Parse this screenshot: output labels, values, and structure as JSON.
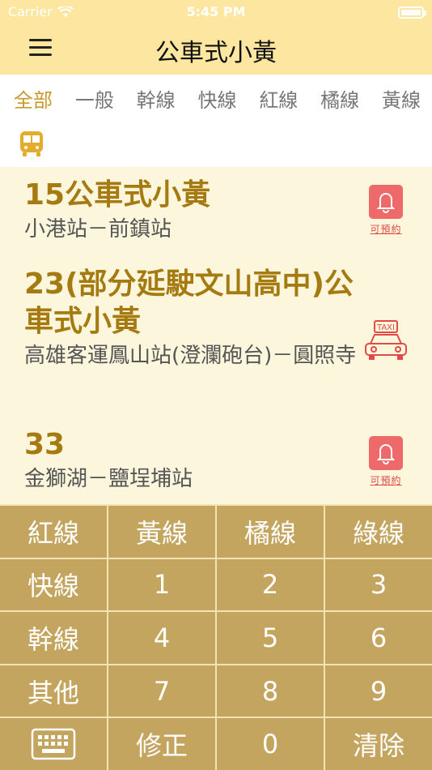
{
  "status_bar": {
    "carrier": "Carrier",
    "time": "5:45 PM"
  },
  "header": {
    "title": "公車式小黃"
  },
  "tabs": [
    {
      "label": "全部",
      "active": true
    },
    {
      "label": "一般"
    },
    {
      "label": "幹線"
    },
    {
      "label": "快線"
    },
    {
      "label": "紅線"
    },
    {
      "label": "橘線"
    },
    {
      "label": "黃線"
    }
  ],
  "routes": [
    {
      "name": "15公車式小黃",
      "stops": "小港站－前鎮站",
      "badge": {
        "icon": "bell-icon",
        "label": "可預約"
      }
    },
    {
      "name": "23(部分延駛文山高中)公車式小黃",
      "stops": "高雄客運鳳山站(澄瀾砲台)－圓照寺",
      "badge": {
        "icon": "taxi-icon",
        "label": "TAXI"
      }
    },
    {
      "name": "33",
      "stops": "金獅湖－鹽埕埔站",
      "badge": {
        "icon": "bell-icon",
        "label": "可預約"
      }
    }
  ],
  "keypad": [
    "紅線",
    "黃線",
    "橘線",
    "綠線",
    "快線",
    "1",
    "2",
    "3",
    "幹線",
    "4",
    "5",
    "6",
    "其他",
    "7",
    "8",
    "9",
    "",
    "修正",
    "0",
    "清除"
  ],
  "colors": {
    "nav_background": "#fce6a0",
    "accent": "#c89a2c",
    "route_name": "#a57a10",
    "list_background": "#fcf6dc",
    "key_background": "#c4a55f",
    "badge_red": "#ee6a6a"
  }
}
